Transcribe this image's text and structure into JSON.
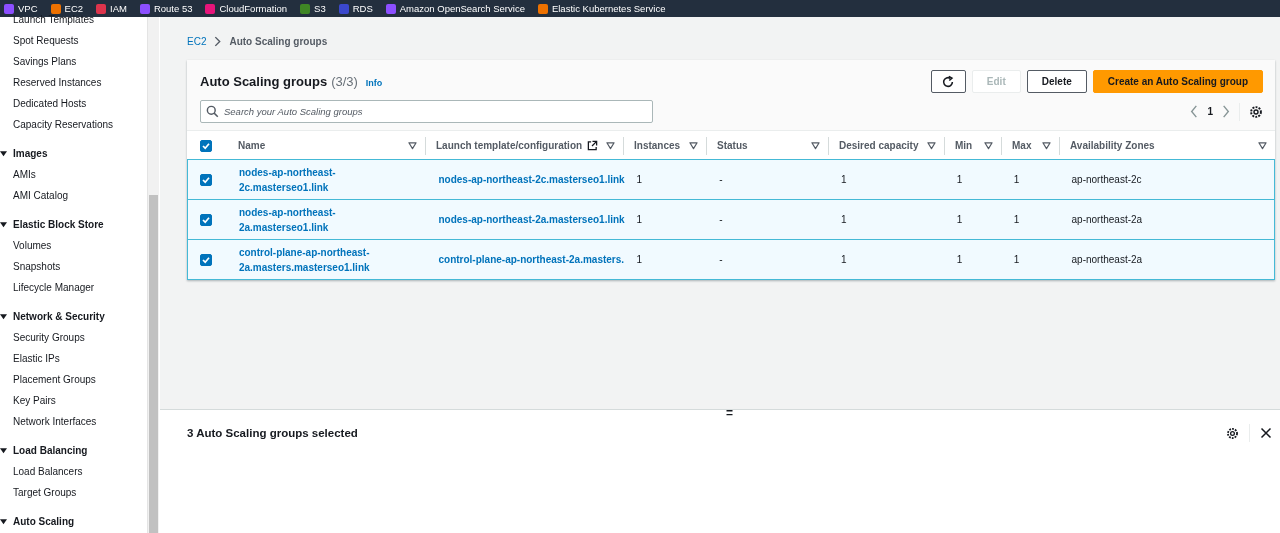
{
  "services": [
    {
      "label": "VPC",
      "color": "#8c4fff"
    },
    {
      "label": "EC2",
      "color": "#ed7100"
    },
    {
      "label": "IAM",
      "color": "#dd344c"
    },
    {
      "label": "Route 53",
      "color": "#8c4fff"
    },
    {
      "label": "CloudFormation",
      "color": "#e7157b"
    },
    {
      "label": "S3",
      "color": "#3f8624"
    },
    {
      "label": "RDS",
      "color": "#3b48cc"
    },
    {
      "label": "Amazon OpenSearch Service",
      "color": "#8c4fff"
    },
    {
      "label": "Elastic Kubernetes Service",
      "color": "#ed7100"
    }
  ],
  "sidebar": {
    "items": [
      {
        "kind": "link",
        "label": "Launch Templates"
      },
      {
        "kind": "link",
        "label": "Spot Requests"
      },
      {
        "kind": "link",
        "label": "Savings Plans"
      },
      {
        "kind": "link",
        "label": "Reserved Instances"
      },
      {
        "kind": "link",
        "label": "Dedicated Hosts"
      },
      {
        "kind": "link",
        "label": "Capacity Reservations"
      },
      {
        "kind": "section",
        "label": "Images",
        "expanded": true
      },
      {
        "kind": "link",
        "label": "AMIs"
      },
      {
        "kind": "link",
        "label": "AMI Catalog"
      },
      {
        "kind": "section",
        "label": "Elastic Block Store",
        "expanded": true
      },
      {
        "kind": "link",
        "label": "Volumes"
      },
      {
        "kind": "link",
        "label": "Snapshots"
      },
      {
        "kind": "link",
        "label": "Lifecycle Manager"
      },
      {
        "kind": "section",
        "label": "Network & Security",
        "expanded": true
      },
      {
        "kind": "link",
        "label": "Security Groups"
      },
      {
        "kind": "link",
        "label": "Elastic IPs"
      },
      {
        "kind": "link",
        "label": "Placement Groups"
      },
      {
        "kind": "link",
        "label": "Key Pairs"
      },
      {
        "kind": "link",
        "label": "Network Interfaces"
      },
      {
        "kind": "section",
        "label": "Load Balancing",
        "expanded": true
      },
      {
        "kind": "link",
        "label": "Load Balancers"
      },
      {
        "kind": "link",
        "label": "Target Groups"
      },
      {
        "kind": "section",
        "label": "Auto Scaling",
        "expanded": true
      }
    ]
  },
  "breadcrumb": [
    "EC2",
    "Auto Scaling groups"
  ],
  "panel": {
    "title": "Auto Scaling groups",
    "count": "(3/3)",
    "info": "Info",
    "buttons": [
      {
        "kind": "refresh",
        "disabled": false
      },
      {
        "kind": "text",
        "label": "Edit",
        "disabled": true
      },
      {
        "kind": "text",
        "label": "Delete",
        "disabled": false
      },
      {
        "kind": "primary",
        "label": "Create an Auto Scaling group",
        "disabled": false
      }
    ],
    "search": {
      "placeholder": "Search your Auto Scaling groups"
    },
    "page": "1"
  },
  "table": {
    "all_checked": true,
    "columns": [
      {
        "label": "Name",
        "external": false
      },
      {
        "label": "Launch template/configuration",
        "external": true
      },
      {
        "label": "Instances",
        "external": false
      },
      {
        "label": "Status",
        "external": false
      },
      {
        "label": "Desired capacity",
        "external": false
      },
      {
        "label": "Min",
        "external": false
      },
      {
        "label": "Max",
        "external": false
      },
      {
        "label": "Availability Zones",
        "external": false
      }
    ],
    "rows": [
      {
        "selected": true,
        "cells": [
          "nodes-ap-northeast-2c.masterseo1.link",
          "nodes-ap-northeast-2c.masterseo1.link",
          "1",
          "-",
          "1",
          "1",
          "1",
          "ap-northeast-2c"
        ]
      },
      {
        "selected": true,
        "cells": [
          "nodes-ap-northeast-2a.masterseo1.link",
          "nodes-ap-northeast-2a.masterseo1.link",
          "1",
          "-",
          "1",
          "1",
          "1",
          "ap-northeast-2a"
        ]
      },
      {
        "selected": true,
        "cells": [
          "control-plane-ap-northeast-2a.masters.masterseo1.link",
          "control-plane-ap-northeast-2a.masters.",
          "1",
          "-",
          "1",
          "1",
          "1",
          "ap-northeast-2a"
        ]
      }
    ]
  },
  "split_panel": {
    "handle": "=",
    "title": "3 Auto Scaling groups selected"
  }
}
